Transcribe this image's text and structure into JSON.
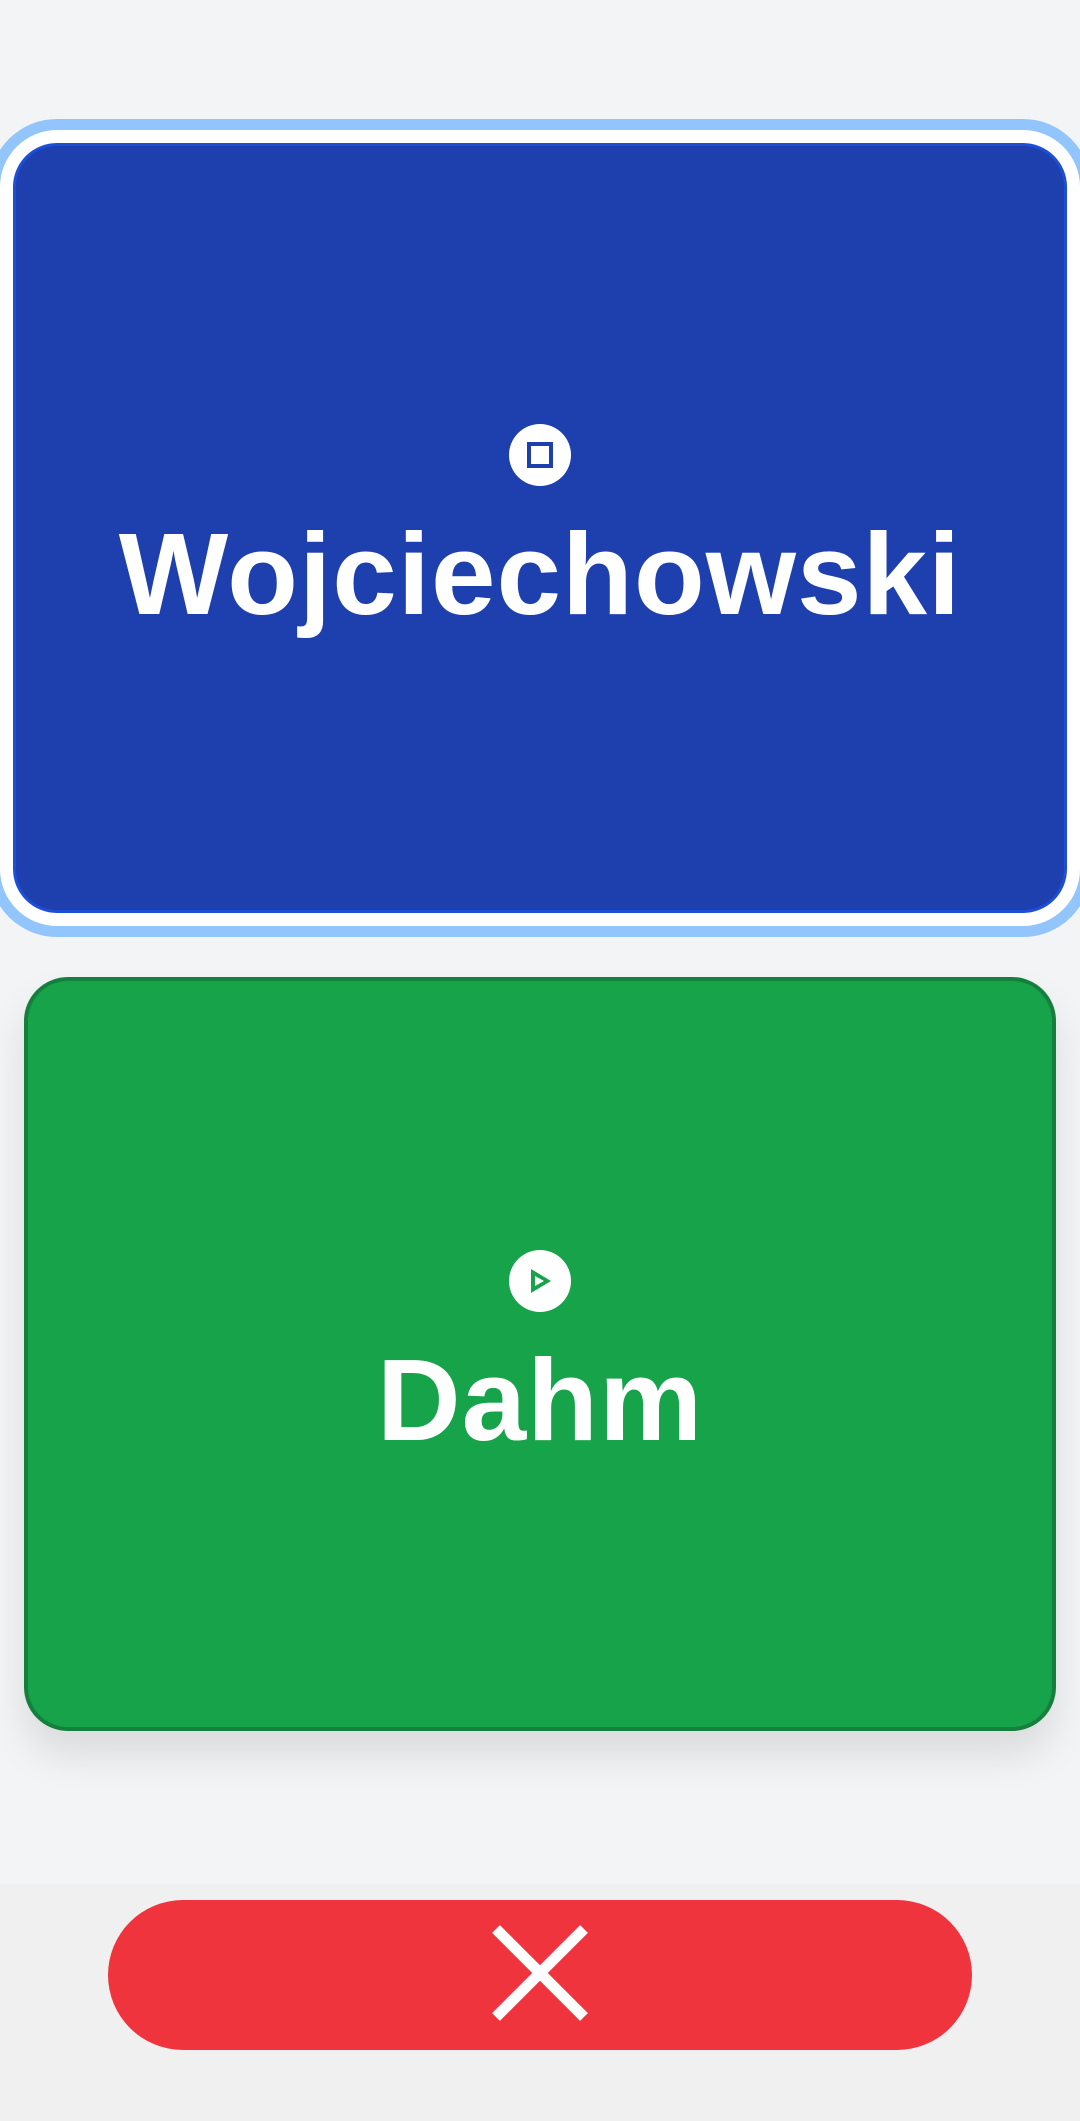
{
  "options": [
    {
      "label": "Wojciechowski",
      "icon": "stop-icon",
      "color": "#1e40af",
      "selected": true
    },
    {
      "label": "Dahm",
      "icon": "play-icon",
      "color": "#16a34a",
      "selected": false
    }
  ],
  "cancel": {
    "icon": "close-icon",
    "color": "#ef343e"
  },
  "colors": {
    "background": "#f3f4f6",
    "selection_ring": "#93c5fd"
  }
}
